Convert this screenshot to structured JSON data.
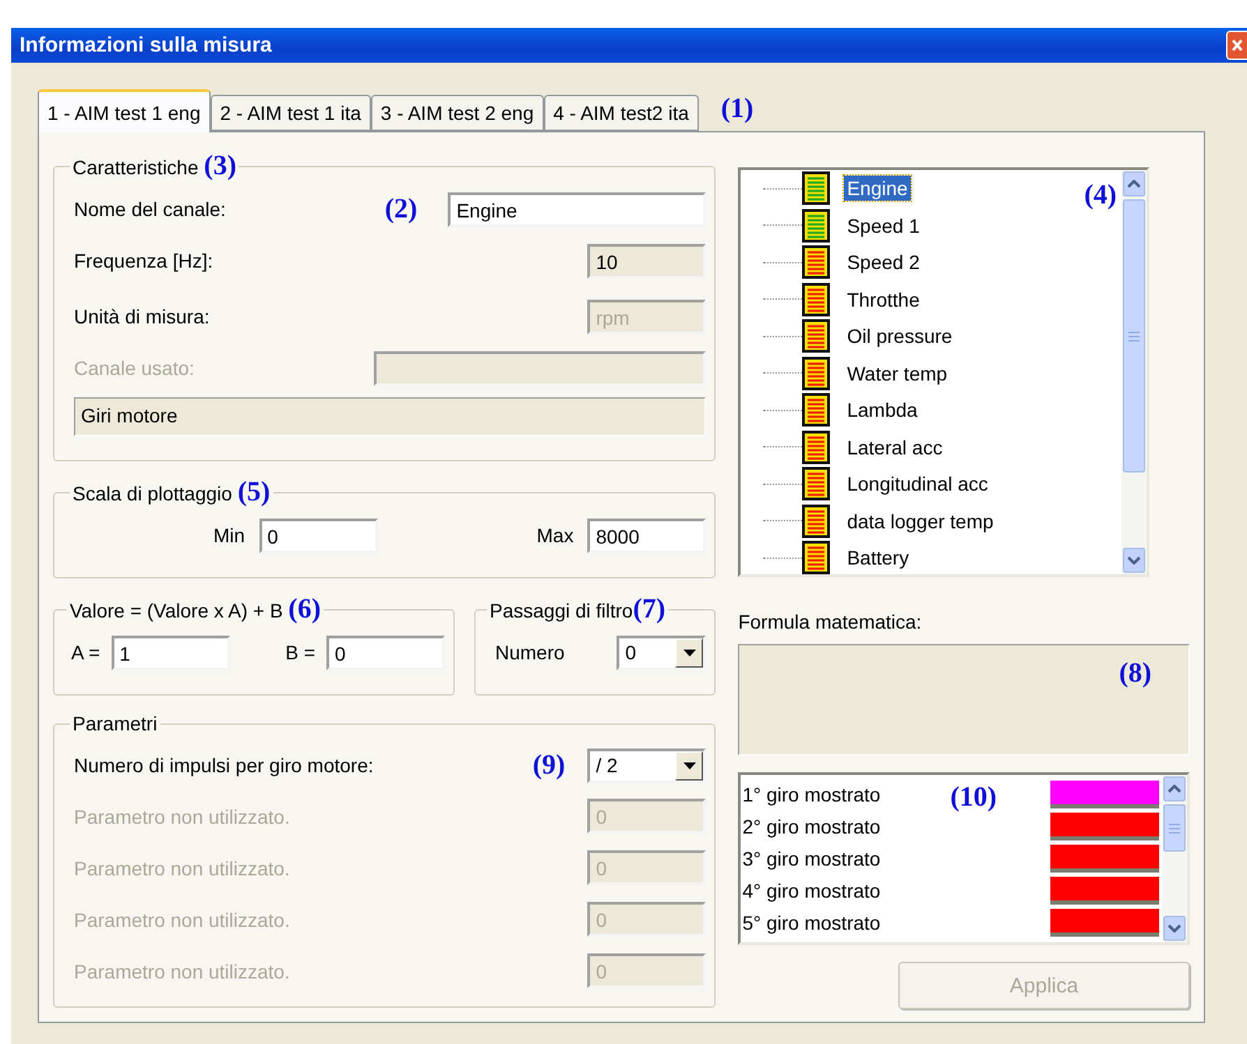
{
  "window": {
    "title": "Informazioni sulla misura"
  },
  "tabs": [
    {
      "label": "1 - AIM test 1 eng",
      "selected": true
    },
    {
      "label": "2 - AIM test 1 ita",
      "selected": false
    },
    {
      "label": "3 - AIM test 2 eng",
      "selected": false
    },
    {
      "label": "4 - AIM test2 ita",
      "selected": false
    }
  ],
  "tabs_callout": "(1)",
  "characteristics": {
    "legend": "Caratteristiche",
    "callout": "(3)",
    "rows": [
      {
        "kind": "field",
        "label": "Nome del canale:",
        "callout": "(2)",
        "value": "Engine",
        "readonly": false,
        "disabled": false
      },
      {
        "kind": "field",
        "label": "Frequenza [Hz]:",
        "value": "10",
        "readonly": true,
        "disabled": false
      },
      {
        "kind": "field",
        "label": "Unità di misura:",
        "value": "rpm",
        "readonly": true,
        "disabled": true
      },
      {
        "kind": "wide-field",
        "label": "Canale usato:",
        "disabled": true
      }
    ],
    "description": "Giri motore"
  },
  "scale": {
    "legend": "Scala di plottaggio",
    "callout": "(5)",
    "min_label": "Min",
    "min": "0",
    "max_label": "Max",
    "max": "8000"
  },
  "linear": {
    "legend": "Valore = (Valore x A) + B",
    "callout": "(6)",
    "a_label": "A =",
    "a": "1",
    "b_label": "B =",
    "b": "0"
  },
  "filter": {
    "legend": "Passaggi di filtro",
    "callout": "(7)",
    "label": "Numero",
    "value": "0"
  },
  "params": {
    "legend": "Parametri",
    "rows": [
      {
        "kind": "select",
        "label": "Numero di impulsi per giro motore:",
        "callout": "(9)",
        "value": "/ 2",
        "disabled": false
      },
      {
        "kind": "field",
        "label": "Parametro non utilizzato.",
        "value": "0",
        "disabled": true
      },
      {
        "kind": "field",
        "label": "Parametro non utilizzato.",
        "value": "0",
        "disabled": true
      },
      {
        "kind": "field",
        "label": "Parametro non utilizzato.",
        "value": "0",
        "disabled": true
      },
      {
        "kind": "field",
        "label": "Parametro non utilizzato.",
        "value": "0",
        "disabled": true
      }
    ]
  },
  "channels": {
    "callout": "(4)",
    "items": [
      {
        "label": "Engine",
        "color": "#22a822",
        "selected": true
      },
      {
        "label": "Speed 1",
        "color": "#22a822",
        "selected": false
      },
      {
        "label": "Speed 2",
        "color": "#ee2200",
        "selected": false
      },
      {
        "label": "Throtthe",
        "color": "#ee2200",
        "selected": false
      },
      {
        "label": "Oil pressure",
        "color": "#ee2200",
        "selected": false
      },
      {
        "label": "Water temp",
        "color": "#ee2200",
        "selected": false
      },
      {
        "label": "Lambda",
        "color": "#ee2200",
        "selected": false
      },
      {
        "label": "Lateral acc",
        "color": "#ee2200",
        "selected": false
      },
      {
        "label": "Longitudinal acc",
        "color": "#ee2200",
        "selected": false
      },
      {
        "label": "data logger temp",
        "color": "#ee2200",
        "selected": false
      },
      {
        "label": "Battery",
        "color": "#ee2200",
        "selected": false
      }
    ]
  },
  "formula": {
    "label": "Formula matematica:",
    "callout": "(8)"
  },
  "laps": {
    "callout": "(10)",
    "items": [
      {
        "label": "1° giro mostrato",
        "color": "#ff00ff"
      },
      {
        "label": "2° giro mostrato",
        "color": "#ff0000"
      },
      {
        "label": "3° giro mostrato",
        "color": "#ff0000"
      },
      {
        "label": "4° giro mostrato",
        "color": "#ff0000"
      },
      {
        "label": "5° giro mostrato",
        "color": "#ff0000"
      }
    ]
  },
  "apply_button": {
    "label": "Applica",
    "disabled": true
  }
}
